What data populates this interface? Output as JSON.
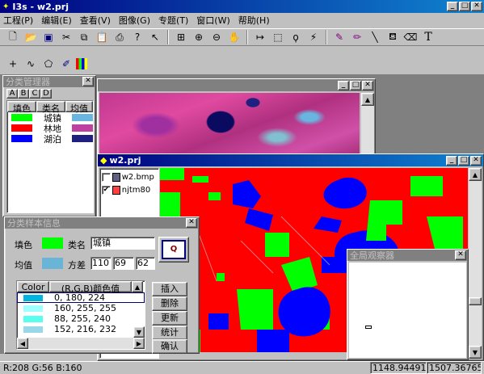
{
  "app": {
    "title": "I3s - w2.prj",
    "menu": [
      "工程(P)",
      "编辑(E)",
      "查看(V)",
      "图像(G)",
      "专题(T)",
      "窗口(W)",
      "帮助(H)"
    ]
  },
  "toolbar1_icons": [
    "new-icon",
    "open-icon",
    "save-icon",
    "cut-icon",
    "copy-icon",
    "paste-icon",
    "print-icon",
    "help-icon",
    "pointer-icon",
    "fullextent-icon",
    "zoomin-icon",
    "zoomout-icon",
    "pan-icon",
    "select-point-icon",
    "rect-select-icon",
    "lasso-icon",
    "magic-wand-icon",
    "eyedropper-icon",
    "pencil-icon",
    "line-icon",
    "fill-icon",
    "eraser-icon",
    "text-icon"
  ],
  "toolbar2_icons": [
    "point-icon",
    "polyline-icon",
    "polygon-icon",
    "edit-icon",
    "palette-icon"
  ],
  "class_manager": {
    "title": "分类管理器",
    "tabs": [
      "A",
      "B",
      "C",
      "D"
    ],
    "headers": [
      "填色",
      "类名",
      "均值"
    ],
    "rows": [
      {
        "fill": "#00ff00",
        "name": "城镇",
        "mean": "#6ab4e0"
      },
      {
        "fill": "#ff0000",
        "name": "林地",
        "mean": "#c040a0"
      },
      {
        "fill": "#0000ff",
        "name": "湖泊",
        "mean": "#202080"
      }
    ]
  },
  "image_window": {
    "title": ""
  },
  "project_window": {
    "title": "w2.prj",
    "layers": [
      {
        "checked": false,
        "name": "w2.bmp"
      },
      {
        "checked": true,
        "name": "njtm80"
      }
    ]
  },
  "sample_dialog": {
    "title": "分类样本信息",
    "fill_label": "填色",
    "fill_color": "#00ff00",
    "classname_label": "类名",
    "classname_value": "城镇",
    "mean_label": "均值",
    "mean_color": "#6ab4d8",
    "variance_label": "方差",
    "variance_values": [
      "110",
      "69",
      "62"
    ],
    "table_headers": [
      "Color",
      "(R,G,B)颜色值"
    ],
    "table_rows": [
      {
        "color": "#00b4e0",
        "rgb": "0, 180, 224"
      },
      {
        "color": "#a0ffff",
        "rgb": "160, 255, 255"
      },
      {
        "color": "#58fff0",
        "rgb": "88, 255, 240"
      },
      {
        "color": "#98d8e8",
        "rgb": "152, 216, 232"
      }
    ],
    "buttons": [
      "插入",
      "删除",
      "更新",
      "统计",
      "确认"
    ]
  },
  "overview": {
    "title": "全局观察器"
  },
  "status": {
    "rgb": "R:208 G:56 B:160",
    "coord_x": "1148.94491",
    "coord_y": "1507.36765("
  }
}
